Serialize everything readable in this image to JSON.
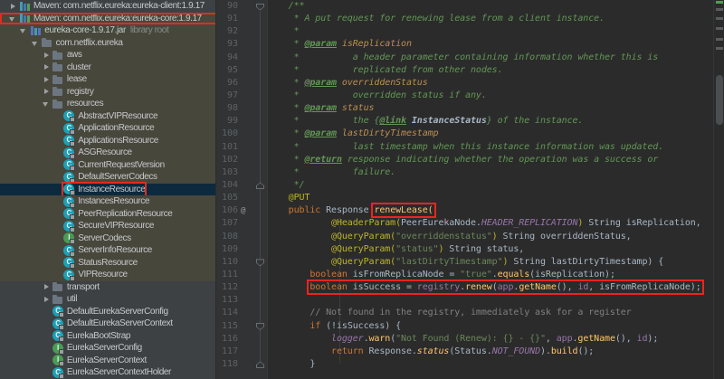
{
  "colors": {
    "editor_bg": "#2B2B2B",
    "tree_bg": "#3E4143",
    "tree_tint": "#48473C",
    "selection_bg": "#0D293E",
    "annotation_box": "#EC2420",
    "keyword": "#CC7832",
    "string": "#6A8759",
    "doc_comment": "#629755"
  },
  "tree": {
    "items": [
      {
        "label": "Maven: com.netflix.eureka:eureka-client:1.9.17",
        "level": 1,
        "icon": "maven",
        "arrow": "closed"
      },
      {
        "label": "Maven: com.netflix.eureka:eureka-core:1.9.17",
        "level": 1,
        "icon": "maven",
        "arrow": "open",
        "box": "row",
        "tint": true
      },
      {
        "label": "eureka-core-1.9.17.jar",
        "suffix": "library root",
        "level": 2,
        "icon": "jar",
        "arrow": "open",
        "tint": true
      },
      {
        "label": "com.netflix.eureka",
        "level": 3,
        "icon": "package",
        "arrow": "open",
        "tint": true
      },
      {
        "label": "aws",
        "level": 4,
        "icon": "folder",
        "arrow": "closed",
        "tint": true
      },
      {
        "label": "cluster",
        "level": 4,
        "icon": "folder",
        "arrow": "closed",
        "tint": true
      },
      {
        "label": "lease",
        "level": 4,
        "icon": "folder",
        "arrow": "closed",
        "tint": true
      },
      {
        "label": "registry",
        "level": 4,
        "icon": "folder",
        "arrow": "closed",
        "tint": true
      },
      {
        "label": "resources",
        "level": 4,
        "icon": "folder",
        "arrow": "open",
        "tint": true
      },
      {
        "label": "AbstractVIPResource",
        "level": 5,
        "icon": "class",
        "tint": true
      },
      {
        "label": "ApplicationResource",
        "level": 5,
        "icon": "class",
        "tint": true
      },
      {
        "label": "ApplicationsResource",
        "level": 5,
        "icon": "class",
        "tint": true
      },
      {
        "label": "ASGResource",
        "level": 5,
        "icon": "class",
        "tint": true
      },
      {
        "label": "CurrentRequestVersion",
        "level": 5,
        "icon": "class",
        "tint": true
      },
      {
        "label": "DefaultServerCodecs",
        "level": 5,
        "icon": "class",
        "tint": true
      },
      {
        "label": "InstanceResource",
        "level": 5,
        "icon": "class",
        "sel": true,
        "box": "item"
      },
      {
        "label": "InstancesResource",
        "level": 5,
        "icon": "class",
        "tint": true
      },
      {
        "label": "PeerReplicationResource",
        "level": 5,
        "icon": "class",
        "tint": true
      },
      {
        "label": "SecureVIPResource",
        "level": 5,
        "icon": "class",
        "tint": true
      },
      {
        "label": "ServerCodecs",
        "level": 5,
        "icon": "interface",
        "tint": true
      },
      {
        "label": "ServerInfoResource",
        "level": 5,
        "icon": "class",
        "tint": true
      },
      {
        "label": "StatusResource",
        "level": 5,
        "icon": "class",
        "tint": true
      },
      {
        "label": "VIPResource",
        "level": 5,
        "icon": "class",
        "tint": true
      },
      {
        "label": "transport",
        "level": 4,
        "icon": "folder",
        "arrow": "closed"
      },
      {
        "label": "util",
        "level": 4,
        "icon": "folder",
        "arrow": "closed"
      },
      {
        "label": "DefaultEurekaServerConfig",
        "level": 4,
        "icon": "class"
      },
      {
        "label": "DefaultEurekaServerContext",
        "level": 4,
        "icon": "class"
      },
      {
        "label": "EurekaBootStrap",
        "level": 4,
        "icon": "class"
      },
      {
        "label": "EurekaServerConfig",
        "level": 4,
        "icon": "interface"
      },
      {
        "label": "EurekaServerContext",
        "level": 4,
        "icon": "interface"
      },
      {
        "label": "EurekaServerContextHolder",
        "level": 4,
        "icon": "class"
      }
    ]
  },
  "editor": {
    "lines": [
      {
        "n": 90,
        "fold": "down",
        "segs": [
          {
            "c": "d",
            "t": "    /**"
          }
        ]
      },
      {
        "n": 91,
        "segs": [
          {
            "c": "d",
            "t": "     * A put request for renewing lease from a client instance."
          }
        ]
      },
      {
        "n": 92,
        "segs": [
          {
            "c": "d",
            "t": "     *"
          }
        ]
      },
      {
        "n": 93,
        "segs": [
          {
            "c": "d",
            "t": "     * "
          },
          {
            "c": "t",
            "t": "@param"
          },
          {
            "c": "v",
            "t": " isReplication"
          }
        ]
      },
      {
        "n": 94,
        "segs": [
          {
            "c": "d",
            "t": "     *          a header parameter containing information whether this is"
          }
        ]
      },
      {
        "n": 95,
        "segs": [
          {
            "c": "d",
            "t": "     *          replicated from other nodes."
          }
        ]
      },
      {
        "n": 96,
        "segs": [
          {
            "c": "d",
            "t": "     * "
          },
          {
            "c": "t",
            "t": "@param"
          },
          {
            "c": "v",
            "t": " overriddenStatus"
          }
        ]
      },
      {
        "n": 97,
        "segs": [
          {
            "c": "d",
            "t": "     *          overridden status if any."
          }
        ]
      },
      {
        "n": 98,
        "segs": [
          {
            "c": "d",
            "t": "     * "
          },
          {
            "c": "t",
            "t": "@param"
          },
          {
            "c": "v",
            "t": " status"
          }
        ]
      },
      {
        "n": 99,
        "segs": [
          {
            "c": "d",
            "t": "     *          the {"
          },
          {
            "c": "t",
            "t": "@link"
          },
          {
            "c": "d",
            "t": " "
          },
          {
            "c": "L",
            "t": "InstanceStatus"
          },
          {
            "c": "d",
            "t": "} of the instance."
          }
        ]
      },
      {
        "n": 100,
        "segs": [
          {
            "c": "d",
            "t": "     * "
          },
          {
            "c": "t",
            "t": "@param"
          },
          {
            "c": "v",
            "t": " lastDirtyTimestamp"
          }
        ]
      },
      {
        "n": 101,
        "segs": [
          {
            "c": "d",
            "t": "     *          last timestamp when this instance information was updated."
          }
        ]
      },
      {
        "n": 102,
        "segs": [
          {
            "c": "d",
            "t": "     * "
          },
          {
            "c": "t",
            "t": "@return"
          },
          {
            "c": "d",
            "t": " response indicating whether the operation was a success or"
          }
        ]
      },
      {
        "n": 103,
        "segs": [
          {
            "c": "d",
            "t": "     *          failure."
          }
        ]
      },
      {
        "n": 104,
        "fold": "up",
        "segs": [
          {
            "c": "d",
            "t": "     */"
          }
        ]
      },
      {
        "n": 105,
        "segs": [
          {
            "c": "a",
            "t": "    @PUT"
          }
        ]
      },
      {
        "n": 106,
        "mark": "@",
        "segs": [
          {
            "c": "k",
            "t": "    public "
          },
          {
            "c": "w",
            "t": "Response "
          },
          {
            "c": "m",
            "t": "renewLease(",
            "b": true
          }
        ]
      },
      {
        "n": 107,
        "segs": [
          {
            "c": "w",
            "t": "            "
          },
          {
            "c": "a",
            "t": "@HeaderParam("
          },
          {
            "c": "w",
            "t": "PeerEurekaNode."
          },
          {
            "c": "F",
            "t": "HEADER_REPLICATION"
          },
          {
            "c": "a",
            "t": ")"
          },
          {
            "c": "w",
            "t": " String isReplication,"
          }
        ]
      },
      {
        "n": 108,
        "segs": [
          {
            "c": "w",
            "t": "            "
          },
          {
            "c": "a",
            "t": "@QueryParam("
          },
          {
            "c": "s",
            "t": "\"overriddenstatus\""
          },
          {
            "c": "a",
            "t": ")"
          },
          {
            "c": "w",
            "t": " String overriddenStatus,"
          }
        ]
      },
      {
        "n": 109,
        "segs": [
          {
            "c": "w",
            "t": "            "
          },
          {
            "c": "a",
            "t": "@QueryParam("
          },
          {
            "c": "s",
            "t": "\"status\""
          },
          {
            "c": "a",
            "t": ")"
          },
          {
            "c": "w",
            "t": " String status,"
          }
        ]
      },
      {
        "n": 110,
        "fold": "down",
        "segs": [
          {
            "c": "w",
            "t": "            "
          },
          {
            "c": "a",
            "t": "@QueryParam("
          },
          {
            "c": "s",
            "t": "\"lastDirtyTimestamp\""
          },
          {
            "c": "a",
            "t": ")"
          },
          {
            "c": "w",
            "t": " String lastDirtyTimestamp) {"
          }
        ]
      },
      {
        "n": 111,
        "segs": [
          {
            "c": "w",
            "t": "        "
          },
          {
            "c": "k",
            "t": "boolean"
          },
          {
            "c": "w",
            "t": " isFromReplicaNode = "
          },
          {
            "c": "s",
            "t": "\"true\""
          },
          {
            "c": "w",
            "t": "."
          },
          {
            "c": "m",
            "t": "equals"
          },
          {
            "c": "w",
            "t": "(isReplication);"
          }
        ]
      },
      {
        "n": 112,
        "ind": "        ",
        "box": true,
        "segs": [
          {
            "c": "k",
            "t": "boolean"
          },
          {
            "c": "w",
            "t": " isSuccess = "
          },
          {
            "c": "f",
            "t": "registry"
          },
          {
            "c": "w",
            "t": "."
          },
          {
            "c": "m",
            "t": "renew"
          },
          {
            "c": "w",
            "t": "("
          },
          {
            "c": "f",
            "t": "app"
          },
          {
            "c": "w",
            "t": "."
          },
          {
            "c": "m",
            "t": "getName"
          },
          {
            "c": "w",
            "t": "(), "
          },
          {
            "c": "f",
            "t": "id"
          },
          {
            "c": "w",
            "t": ", isFromReplicaNode);"
          }
        ]
      },
      {
        "n": 113,
        "segs": []
      },
      {
        "n": 114,
        "segs": [
          {
            "c": "w",
            "t": "        "
          },
          {
            "c": "g",
            "t": "// Not found in the registry, immediately ask for a register"
          }
        ]
      },
      {
        "n": 115,
        "fold": "down",
        "segs": [
          {
            "c": "w",
            "t": "        "
          },
          {
            "c": "k",
            "t": "if"
          },
          {
            "c": "w",
            "t": " (!isSuccess) {"
          }
        ]
      },
      {
        "n": 116,
        "segs": [
          {
            "c": "w",
            "t": "            "
          },
          {
            "c": "F",
            "t": "logger"
          },
          {
            "c": "w",
            "t": "."
          },
          {
            "c": "m",
            "t": "warn"
          },
          {
            "c": "w",
            "t": "("
          },
          {
            "c": "s",
            "t": "\"Not Found (Renew): {} - {}\""
          },
          {
            "c": "w",
            "t": ", "
          },
          {
            "c": "f",
            "t": "app"
          },
          {
            "c": "w",
            "t": "."
          },
          {
            "c": "m",
            "t": "getName"
          },
          {
            "c": "w",
            "t": "(), "
          },
          {
            "c": "f",
            "t": "id"
          },
          {
            "c": "w",
            "t": ");"
          }
        ]
      },
      {
        "n": 117,
        "segs": [
          {
            "c": "w",
            "t": "            "
          },
          {
            "c": "k",
            "t": "return"
          },
          {
            "c": "w",
            "t": " Response."
          },
          {
            "c": "M",
            "t": "status"
          },
          {
            "c": "w",
            "t": "(Status."
          },
          {
            "c": "F",
            "t": "NOT_FOUND"
          },
          {
            "c": "w",
            "t": ")."
          },
          {
            "c": "m",
            "t": "build"
          },
          {
            "c": "w",
            "t": "();"
          }
        ]
      },
      {
        "n": 118,
        "fold": "up",
        "segs": [
          {
            "c": "w",
            "t": "        }"
          }
        ]
      }
    ],
    "stripe_marks": [
      {
        "y": 1,
        "color": "#4F9E54",
        "kind": "ok"
      },
      {
        "y": 9,
        "color": "#5A5D5F",
        "kind": "info"
      },
      {
        "y": 19,
        "color": "#5A5D5F",
        "kind": "info"
      },
      {
        "y": 30,
        "color": "#5A5D5F",
        "kind": "info"
      },
      {
        "y": 42,
        "color": "#5A5D5F",
        "kind": "info"
      },
      {
        "y": 52,
        "color": "#5A5D5F",
        "kind": "info"
      }
    ]
  }
}
